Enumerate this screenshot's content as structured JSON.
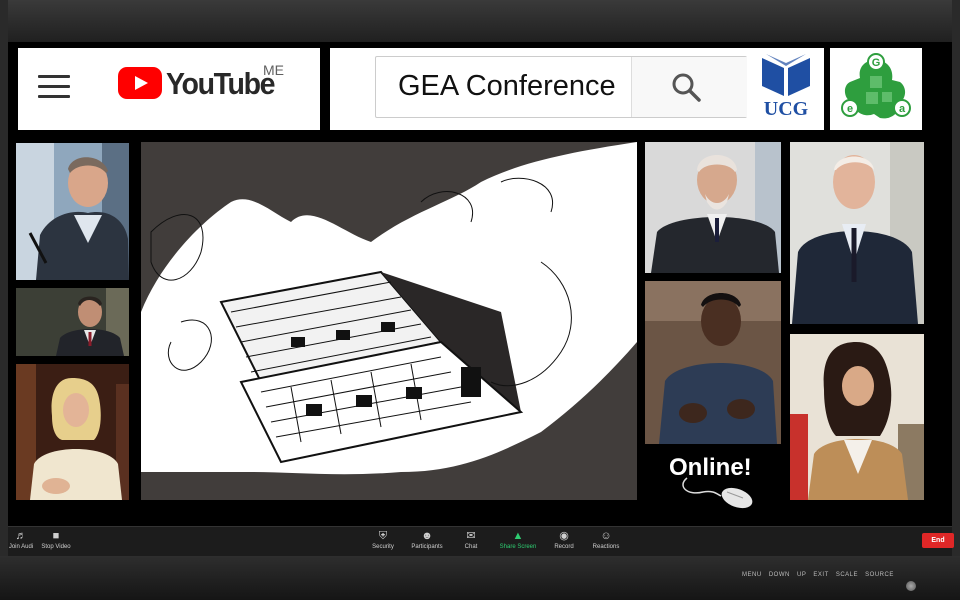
{
  "youtube": {
    "logo_text": "YouTube",
    "region": "ME"
  },
  "search": {
    "query": "GEA Conference"
  },
  "ucg": {
    "logo_text": "UCG"
  },
  "gea": {
    "letters": [
      "G",
      "e",
      "a"
    ]
  },
  "online_badge": "Online!",
  "toolbar": {
    "left_items": [
      {
        "icon": "headphones-icon",
        "label": "Join Audi"
      },
      {
        "icon": "video-camera-icon",
        "label": "Stop Video"
      }
    ],
    "center_items": [
      {
        "icon": "shield-icon",
        "label": "Security"
      },
      {
        "icon": "participants-icon",
        "label": "Participants"
      },
      {
        "icon": "chat-icon",
        "label": "Chat"
      },
      {
        "icon": "share-screen-icon",
        "label": "Share Screen"
      },
      {
        "icon": "record-icon",
        "label": "Record"
      },
      {
        "icon": "reactions-icon",
        "label": "Reactions"
      }
    ],
    "end_label": "End"
  },
  "monitor": {
    "menu_labels": [
      "MENU",
      "DOWN",
      "UP",
      "EXIT",
      "SCALE SOURCE"
    ]
  },
  "colors": {
    "youtube_red": "#ff0000",
    "ucg_blue": "#1f4fa3",
    "gea_green": "#2e9e3e",
    "share_green": "#2ecc71",
    "end_red": "#e02727"
  }
}
